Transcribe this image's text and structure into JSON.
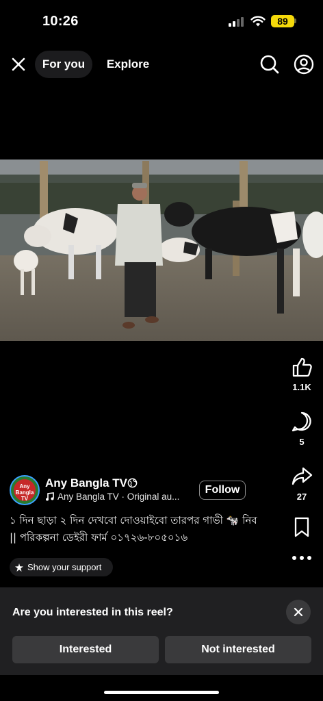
{
  "status_bar": {
    "time": "10:26",
    "battery": "89"
  },
  "nav": {
    "tab_for_you": "For you",
    "tab_explore": "Explore"
  },
  "actions": {
    "likes": "1.1K",
    "comments": "5",
    "shares": "27"
  },
  "author": {
    "name": "Any Bangla TV",
    "avatar_text": "Any Bangla TV",
    "audio": "Any Bangla TV · Original au...",
    "follow_label": "Follow"
  },
  "caption": {
    "line1": "১ দিন ছাড়া ২ দিন দেখবো দোওয়াইবো তারপর গাভী 🐄 নিব",
    "line2": "|| পরিকল্পনা ডেইরী ফার্ম ০১৭২৬-৮০৫০১৬"
  },
  "support_label": "Show your support",
  "interest_panel": {
    "question": "Are you interested in this reel?",
    "interested_label": "Interested",
    "not_interested_label": "Not interested"
  },
  "colors": {
    "background": "#000000",
    "battery": "#f5d90a",
    "panel": "#202022",
    "button": "#3a3a3c"
  }
}
